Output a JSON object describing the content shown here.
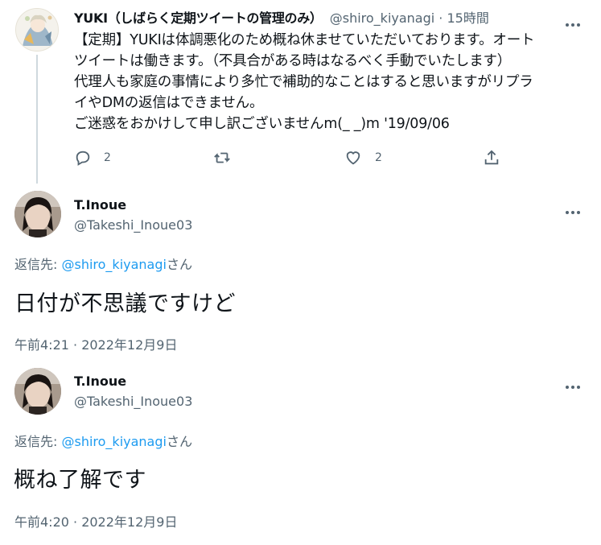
{
  "colors": {
    "text": "#0f1419",
    "muted": "#536471",
    "link": "#1d9bf0",
    "thread_line": "#cfd9de"
  },
  "parent_tweet": {
    "display_name": "YUKI（しばらく定期ツイートの管理のみ）",
    "handle": "@shiro_kiyanagi",
    "separator": "·",
    "time": "15時間",
    "lines": [
      "【定期】YUKIは体調悪化のため概ね休ませていただいております。オート",
      "ツイートは働きます。（不具合がある時はなるべく手動でいたします）",
      "代理人も家庭の事情により多忙で補助的なことはすると思いますがリプラ",
      "イやDMの返信はできません。",
      "ご迷惑をおかけして申し訳ございませんm(_ _)m '19/09/06"
    ],
    "reply_count": "2",
    "retweet_count": "",
    "like_count": "2",
    "icons": [
      "reply-icon",
      "retweet-icon",
      "like-icon",
      "share-icon"
    ]
  },
  "replies": [
    {
      "display_name": "T.Inoue",
      "handle": "@Takeshi_Inoue03",
      "replying_prefix": "返信先: ",
      "replying_to": "@shiro_kiyanagi",
      "replying_suffix": "さん",
      "text": "日付が不思議ですけど",
      "timestamp": "午前4:21 · 2022年12月9日"
    },
    {
      "display_name": "T.Inoue",
      "handle": "@Takeshi_Inoue03",
      "replying_prefix": "返信先: ",
      "replying_to": "@shiro_kiyanagi",
      "replying_suffix": "さん",
      "text": "概ね了解です",
      "timestamp": "午前4:20 · 2022年12月9日"
    }
  ]
}
